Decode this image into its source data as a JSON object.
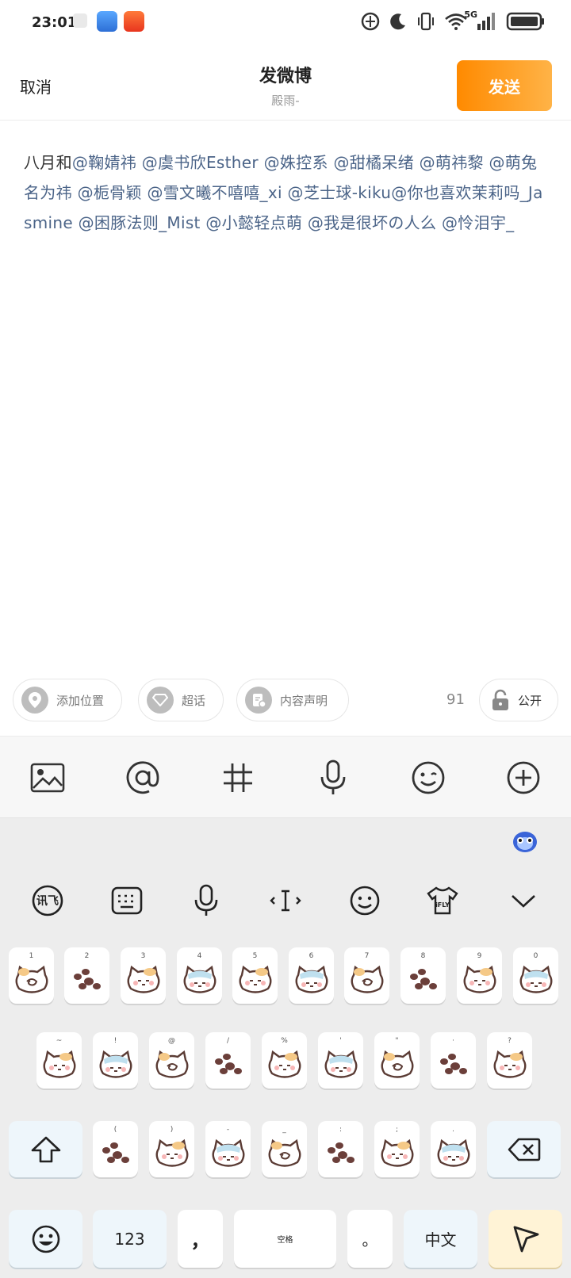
{
  "status_bar": {
    "time": "23:01",
    "network": "5G",
    "icons": [
      "app-icon-small",
      "notes-app-icon",
      "shopping-app-icon",
      "data-saver-icon",
      "do-not-disturb-moon-icon",
      "vibrate-icon",
      "wifi-icon",
      "signal-icon",
      "battery-icon"
    ]
  },
  "header": {
    "cancel_label": "取消",
    "title": "发微博",
    "subtitle": "殿雨-",
    "send_label": "发送"
  },
  "compose": {
    "prefix": "八月和",
    "mentions": [
      "@鞠婧祎",
      "@虞书欣Esther",
      "@姝控系",
      "@甜橘呆绪",
      "@萌祎黎",
      "@萌兔名为祎",
      "@栀骨颖",
      "@雪文曦不嘻嘻_xi",
      "@芝士球-kiku",
      "@你也喜欢茉莉吗_Jasmine",
      "@困豚法则_Mist",
      "@小懿轻点萌",
      "@我是很坏の人么",
      "@怜泪宇_"
    ]
  },
  "actions": {
    "location_label": "添加位置",
    "super_topic_label": "超话",
    "content_declaration_label": "内容声明",
    "remaining_count": "91",
    "visibility_label": "公开"
  },
  "toolbar": {
    "icons": [
      "image-icon",
      "at-icon",
      "hashtag-icon",
      "microphone-icon",
      "emoji-icon",
      "add-icon"
    ]
  },
  "keyboard": {
    "top_icons": [
      "ifly-logo-icon",
      "keyboard-layout-icon",
      "voice-input-icon",
      "cursor-icon",
      "emoji-face-icon",
      "theme-shirt-icon",
      "collapse-chevron-icon"
    ],
    "theme_label": "iFLY",
    "row1_hints": [
      "1",
      "2",
      "3",
      "4",
      "5",
      "6",
      "7",
      "8",
      "9",
      "0"
    ],
    "row2_hints": [
      "~",
      "!",
      "@",
      "/",
      "%",
      "'",
      "\"",
      "·",
      "?"
    ],
    "row3_hints": [
      "(",
      ")",
      "-",
      "_",
      ":",
      ";",
      "."
    ],
    "bottom": {
      "numbers_label": "123",
      "comma_label": "，",
      "space_label": "空格",
      "period_label": "。",
      "lang_label": "中文"
    },
    "accent_color": "#ffb347"
  }
}
